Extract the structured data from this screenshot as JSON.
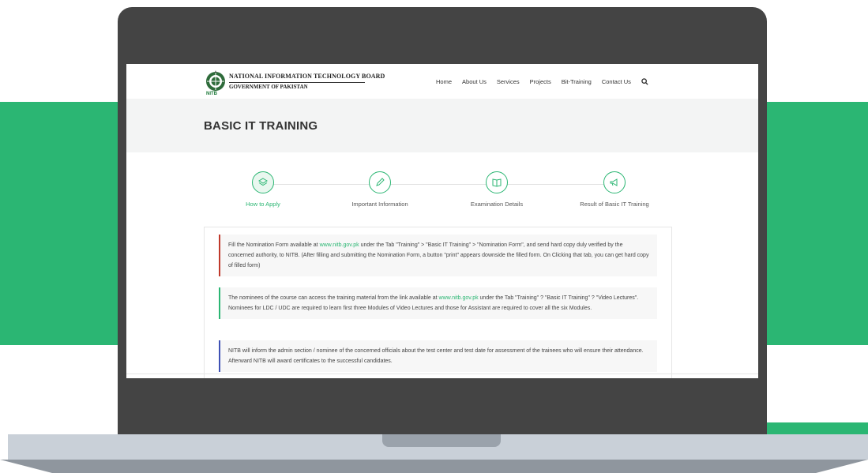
{
  "header": {
    "org_name": "NATIONAL INFORMATION TECHNOLOGY BOARD",
    "org_sub": "GOVERNMENT OF PAKISTAN",
    "logo_abbr": "NITB"
  },
  "nav": {
    "items": [
      "Home",
      "About Us",
      "Services",
      "Projects",
      "Bit-Training",
      "Contact Us"
    ],
    "search_icon": "search-icon"
  },
  "page": {
    "title": "BASIC IT TRAINING"
  },
  "steps": [
    {
      "label": "How to Apply",
      "icon": "layers-icon",
      "active": true
    },
    {
      "label": "Important Information",
      "icon": "pencil-icon",
      "active": false
    },
    {
      "label": "Examination Details",
      "icon": "book-icon",
      "active": false
    },
    {
      "label": "Result of Basic IT Training",
      "icon": "megaphone-icon",
      "active": false
    }
  ],
  "content": {
    "items": [
      {
        "color": "#c0392b",
        "pre": "Fill the Nomination Form available at ",
        "link": "www.nitb.gov.pk",
        "post": " under the Tab \"Training\"  >  \"Basic IT Training\"  >  \"Nomination Form\", and send hard copy duly verified by the concerned authority, to NITB. (After filling and submitting the Nomination Form, a button \"print\" appears downside the filled form. On Clicking that tab, you can get hard copy of filled form)"
      },
      {
        "color": "#2bb673",
        "pre": "The nominees of the course can access the training material from the link available at ",
        "link": "www.nitb.gov.pk",
        "post": " under the Tab \"Training\"  ?  \"Basic IT Training\"  ?  \"Video Lectures\". Nominees for LDC / UDC are required to learn first three Modules of Video Lectures and those for Assistant are required to cover all the six Modules."
      },
      {
        "color": "#3f51b5",
        "pre": "NITB will inform the admin section / nominee of the concerned officials about the test center and test date for assessment of the trainees who will ensure their attendance. Afterward NITB will award certificates to the successful candidates.",
        "link": "",
        "post": ""
      }
    ]
  },
  "colors": {
    "brand_green": "#2bb673",
    "laptop_body": "#444444",
    "laptop_base": "#c9d0d8"
  }
}
